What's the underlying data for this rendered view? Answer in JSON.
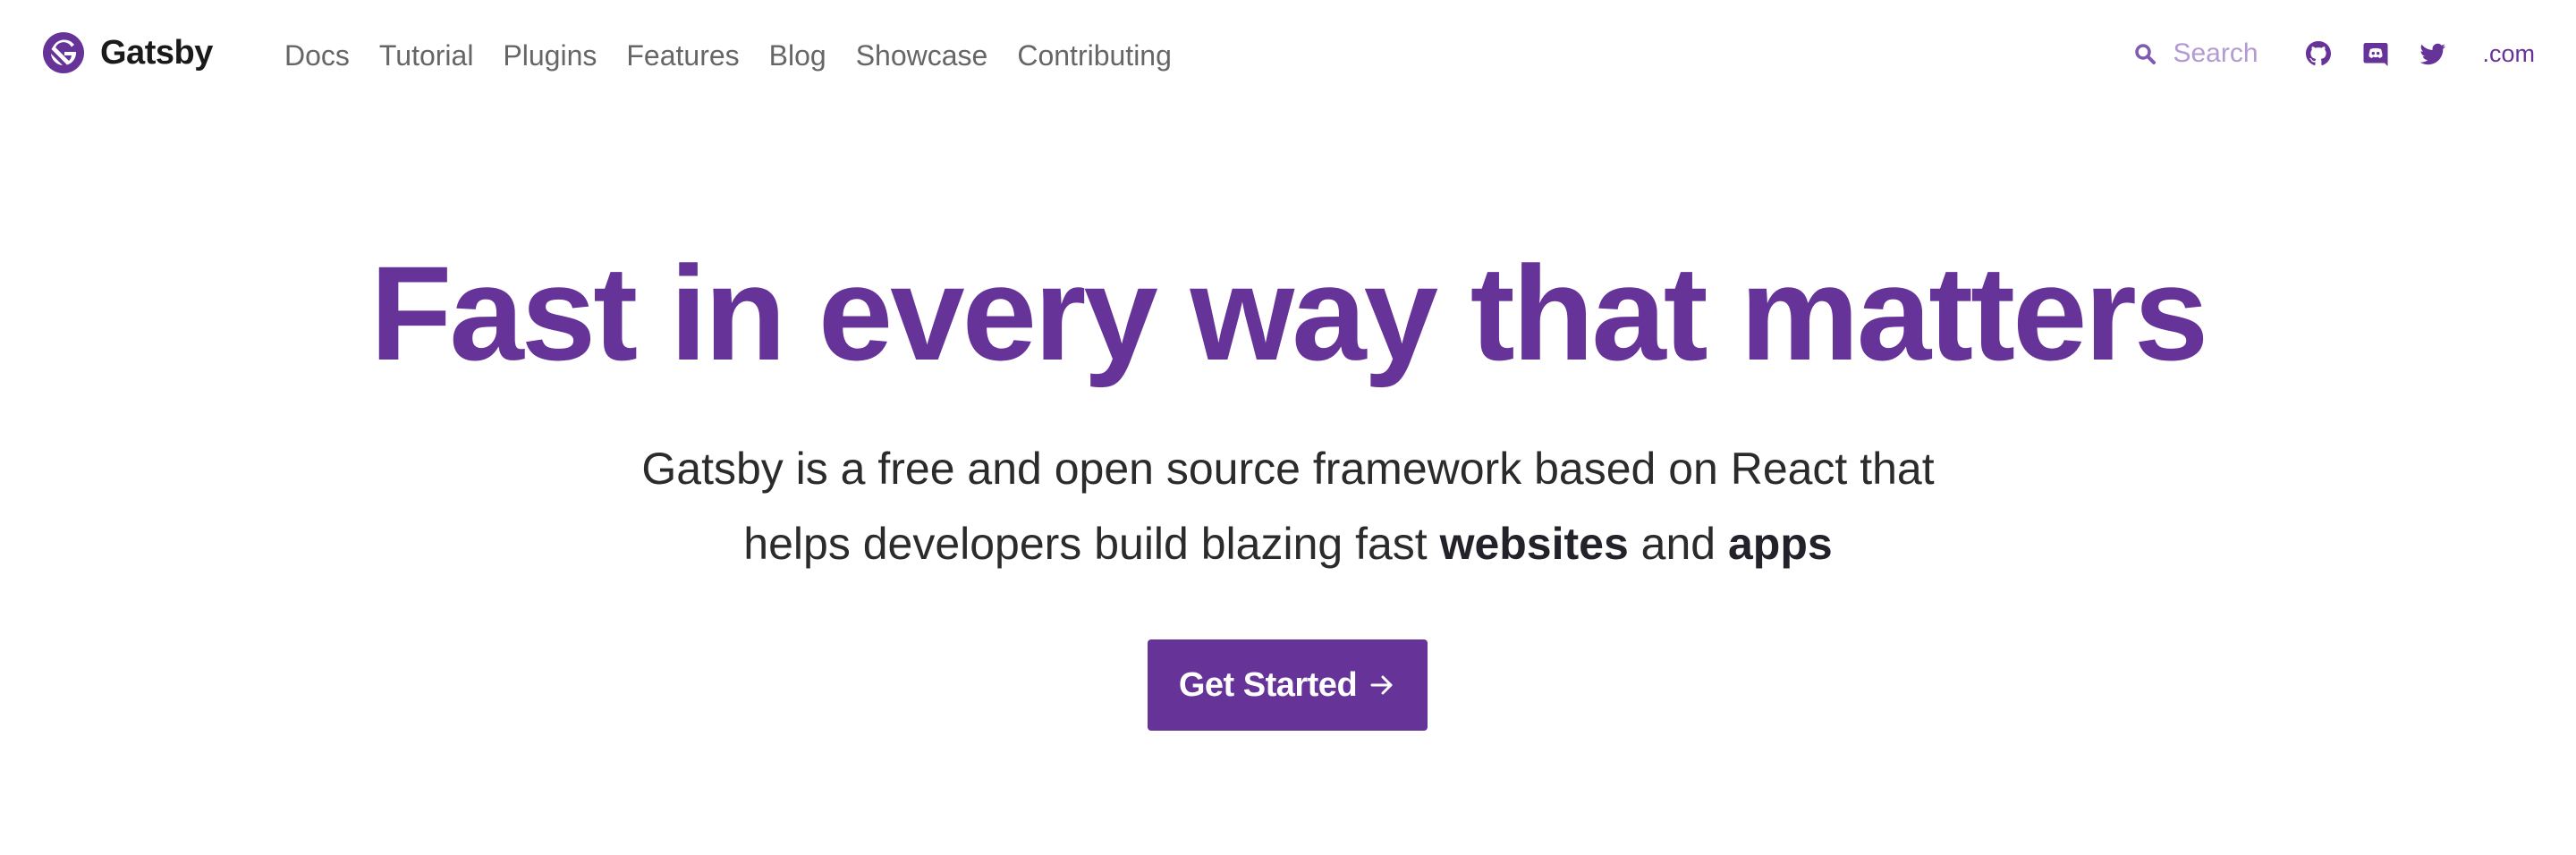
{
  "brand": {
    "name": "Gatsby",
    "logo_icon": "gatsby-logo-icon",
    "color": "#663399"
  },
  "nav": {
    "links": [
      "Docs",
      "Tutorial",
      "Plugins",
      "Features",
      "Blog",
      "Showcase",
      "Contributing"
    ]
  },
  "search": {
    "placeholder": "Search",
    "icon": "search-icon"
  },
  "social": {
    "icons": [
      "github-icon",
      "discord-icon",
      "twitter-icon"
    ],
    "dotcom_label": ".com"
  },
  "hero": {
    "title": "Fast in every way that matters",
    "subtitle_line1": "Gatsby is a free and open source framework based on React that",
    "subtitle_line2_prefix": "helps developers build blazing fast ",
    "subtitle_bold1": "websites",
    "subtitle_and": " and ",
    "subtitle_bold2": "apps",
    "cta_label": "Get Started",
    "cta_icon": "arrow-right-icon"
  },
  "colors": {
    "accent": "#663399",
    "text": "#232129",
    "nav_text": "#666666",
    "search_text": "#b49ad2"
  }
}
